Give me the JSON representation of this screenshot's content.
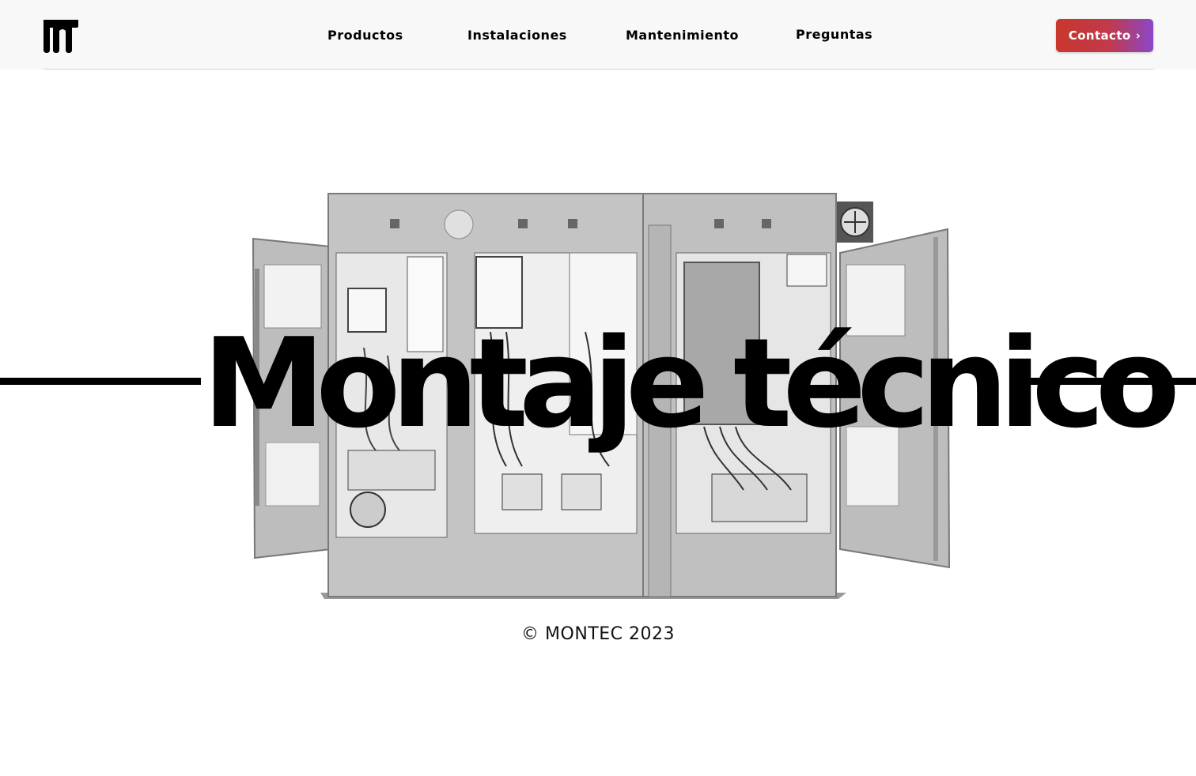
{
  "header": {
    "logo_icon": "montec-logo-icon",
    "nav": [
      {
        "label": "Productos"
      },
      {
        "label": "Instalaciones"
      },
      {
        "label": "Mantenimiento"
      },
      {
        "label": "Preguntas"
      }
    ],
    "contact_label": "Contacto",
    "contact_icon": "chevron-right-icon",
    "contact_colors": [
      "#c9372c",
      "#8a47c9"
    ]
  },
  "hero": {
    "title": "Montaje técnico",
    "image_icon": "electrical-cabinet-image"
  },
  "footer": {
    "copyright": "© MONTEC 2023"
  }
}
